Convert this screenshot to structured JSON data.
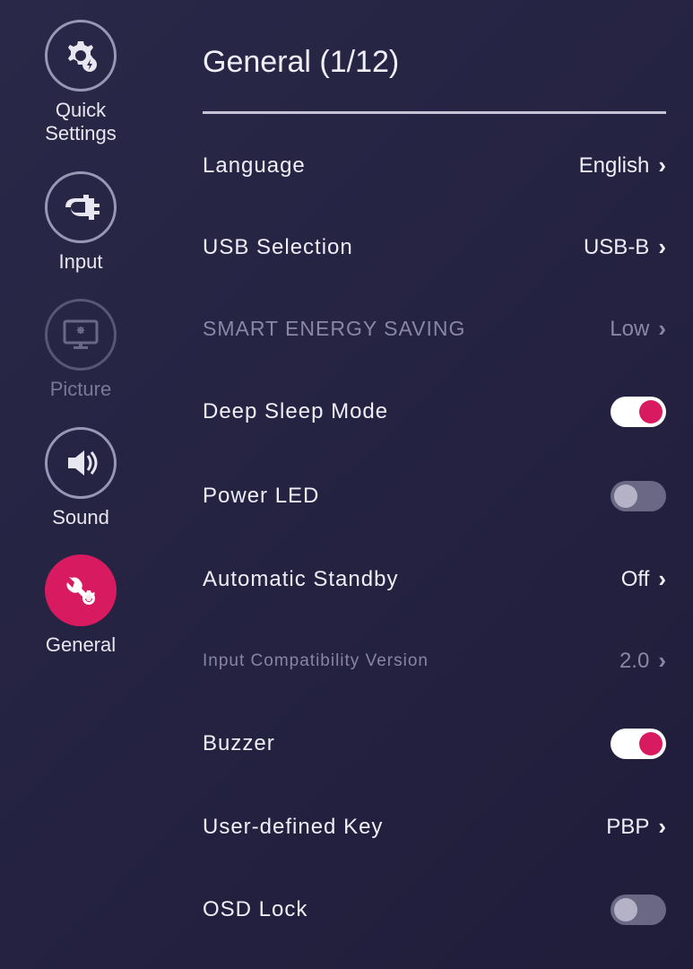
{
  "sidebar": {
    "items": [
      {
        "label": "Quick\nSettings",
        "icon": "gear-bolt",
        "state": "normal"
      },
      {
        "label": "Input",
        "icon": "plug",
        "state": "normal"
      },
      {
        "label": "Picture",
        "icon": "monitor",
        "state": "dim"
      },
      {
        "label": "Sound",
        "icon": "speaker",
        "state": "normal"
      },
      {
        "label": "General",
        "icon": "wrench-gear",
        "state": "active"
      }
    ]
  },
  "page": {
    "title": "General (1/12)"
  },
  "settings": [
    {
      "label": "Language",
      "value": "English",
      "type": "select",
      "style": "normal"
    },
    {
      "label": "USB Selection",
      "value": "USB-B",
      "type": "select",
      "style": "normal"
    },
    {
      "label": "SMART ENERGY SAVING",
      "value": "Low",
      "type": "select",
      "style": "dim"
    },
    {
      "label": "Deep Sleep Mode",
      "value": "on",
      "type": "toggle",
      "style": "normal"
    },
    {
      "label": "Power LED",
      "value": "off",
      "type": "toggle",
      "style": "normal"
    },
    {
      "label": "Automatic Standby",
      "value": "Off",
      "type": "select",
      "style": "normal"
    },
    {
      "label": "Input Compatibility Version",
      "value": "2.0",
      "type": "select",
      "style": "small"
    },
    {
      "label": "Buzzer",
      "value": "on",
      "type": "toggle",
      "style": "normal"
    },
    {
      "label": "User-defined Key",
      "value": "PBP",
      "type": "select",
      "style": "normal"
    },
    {
      "label": "OSD Lock",
      "value": "off",
      "type": "toggle",
      "style": "normal"
    }
  ]
}
